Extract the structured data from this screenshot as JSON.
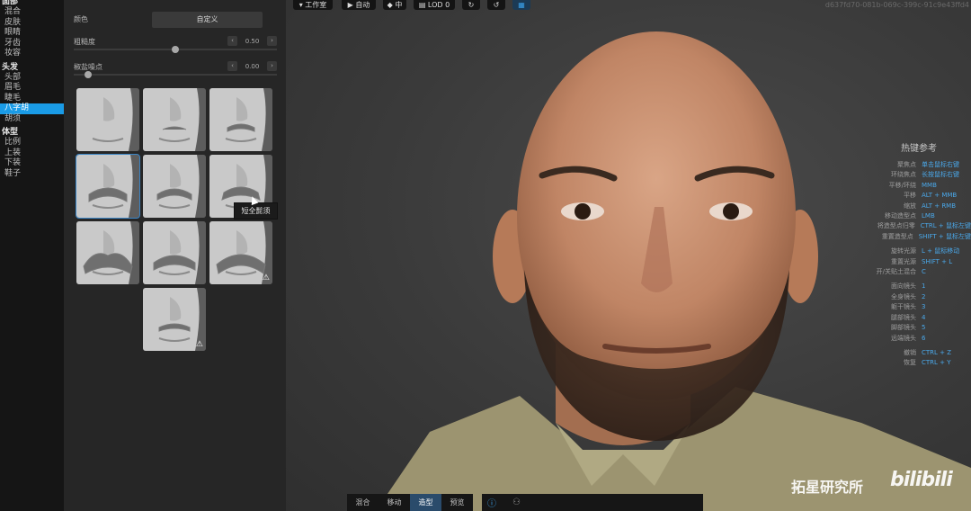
{
  "nav": {
    "group_face": "面部",
    "face_items": [
      "混合",
      "皮肤",
      "眼睛",
      "牙齿",
      "妆容"
    ],
    "group_hair": "头发",
    "hair_items": [
      "头部",
      "眉毛",
      "睫毛",
      "八字胡",
      "胡须"
    ],
    "group_body": "体型",
    "body_items": [
      "比例",
      "上装",
      "下装",
      "鞋子"
    ],
    "active": "八字胡"
  },
  "panel": {
    "color_label": "颜色",
    "color_value": "自定义",
    "roughness_label": "粗糙度",
    "roughness_value": "0.50",
    "roughness_level": 0.5,
    "salt_label": "椒盐噪点",
    "salt_value": "0.00",
    "salt_level": 0.0,
    "tooltip": "短全髭须",
    "selected_index": 3,
    "warning_glyph": "⚠",
    "warning_indices": [
      8,
      9
    ]
  },
  "toolbar": {
    "work": "工作室",
    "auto": "自动",
    "mid": "中",
    "lod": "LOD 0",
    "guid": "d637fd70-081b-069c-399c-91c9e43ffd4"
  },
  "hotkeys": {
    "title": "热键参考",
    "rows": [
      {
        "label": "聚焦点",
        "key": "单击鼠标右键"
      },
      {
        "label": "环绕焦点",
        "key": "长按鼠标右键"
      },
      {
        "label": "平移/环绕",
        "key": "MMB"
      },
      {
        "label": "平移",
        "key": "ALT + MMB"
      },
      {
        "label": "缩放",
        "key": "ALT + RMB"
      },
      {
        "label": "移动造型点",
        "key": "LMB"
      },
      {
        "label": "将造型点归零",
        "key": "CTRL + 鼠标左键"
      },
      {
        "label": "重置造型点",
        "key": "SHIFT + 鼠标左键"
      },
      {
        "label": "旋转光源",
        "key": "L + 鼠标移动"
      },
      {
        "label": "重置光源",
        "key": "SHIFT + L"
      },
      {
        "label": "开/关贴土混合",
        "key": "C"
      },
      {
        "label": "面向镜头",
        "key": "1"
      },
      {
        "label": "全身镜头",
        "key": "2"
      },
      {
        "label": "躯干镜头",
        "key": "3"
      },
      {
        "label": "腿部镜头",
        "key": "4"
      },
      {
        "label": "脚部镜头",
        "key": "5"
      },
      {
        "label": "远端镜头",
        "key": "6"
      },
      {
        "label": "撤销",
        "key": "CTRL + Z"
      },
      {
        "label": "恢复",
        "key": "CTRL + Y"
      }
    ]
  },
  "modes": {
    "tabs": [
      "混合",
      "移动",
      "造型",
      "预览"
    ],
    "active": "造型"
  },
  "watermark": {
    "channel": "拓星研究所",
    "logo": "bilibili"
  },
  "colors": {
    "accent": "#1a9be6",
    "hotkey": "#4aa8ea",
    "panel_bg": "#262626"
  }
}
